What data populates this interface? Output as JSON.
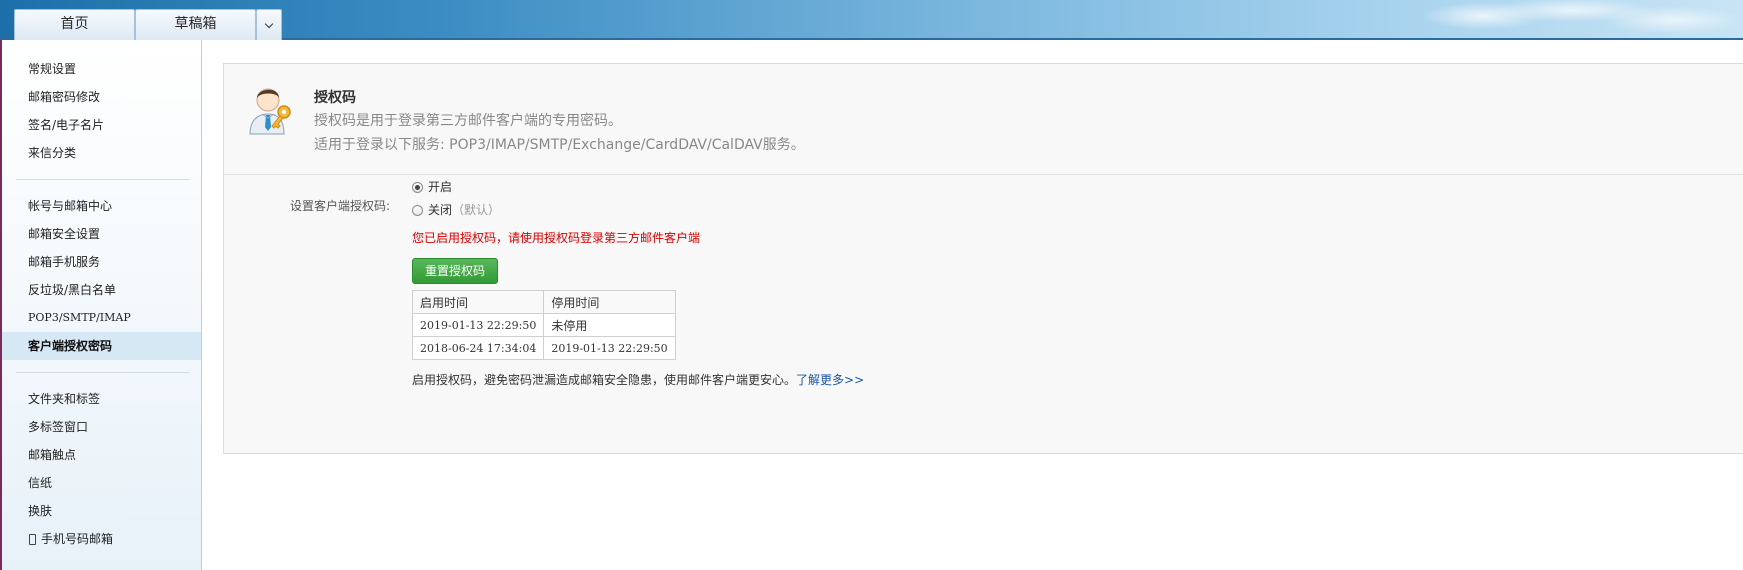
{
  "header": {
    "tabs": [
      {
        "label": "首页"
      },
      {
        "label": "草稿箱"
      }
    ]
  },
  "sidebar": {
    "groups": [
      {
        "items": [
          {
            "label": "常规设置"
          },
          {
            "label": "邮箱密码修改"
          },
          {
            "label": "签名/电子名片"
          },
          {
            "label": "来信分类"
          }
        ]
      },
      {
        "items": [
          {
            "label": "帐号与邮箱中心"
          },
          {
            "label": "邮箱安全设置"
          },
          {
            "label": "邮箱手机服务"
          },
          {
            "label": "反垃圾/黑白名单"
          },
          {
            "label": "POP3/SMTP/IMAP"
          },
          {
            "label": "客户端授权密码",
            "active": true
          }
        ]
      },
      {
        "items": [
          {
            "label": "文件夹和标签"
          },
          {
            "label": "多标签窗口"
          },
          {
            "label": "邮箱触点"
          },
          {
            "label": "信纸"
          },
          {
            "label": "换肤"
          },
          {
            "label": "手机号码邮箱",
            "icon": "phone-icon"
          }
        ]
      }
    ]
  },
  "main": {
    "title": "授权码",
    "desc_line1": "授权码是用于登录第三方邮件客户端的专用密码。",
    "desc_line2": "适用于登录以下服务: POP3/IMAP/SMTP/Exchange/CardDAV/CalDAV服务。",
    "header_icon": "user-key-icon",
    "setting_label": "设置客户端授权码:",
    "options": {
      "on_label": "开启",
      "off_label": "关闭",
      "off_hint": "（默认）",
      "selected": "on"
    },
    "warning": "您已启用授权码，请使用授权码登录第三方邮件客户端",
    "reset_button": "重置授权码",
    "table": {
      "headers": [
        "启用时间",
        "停用时间"
      ],
      "rows": [
        [
          "2019-01-13 22:29:50",
          "未停用"
        ],
        [
          "2018-06-24 17:34:04",
          "2019-01-13 22:29:50"
        ]
      ]
    },
    "footer_text": "启用授权码，避免密码泄漏造成邮箱安全隐患，使用邮件客户端更安心。",
    "learn_more": "了解更多>>"
  },
  "colors": {
    "warning": "#d40000",
    "button": "#3aa23d",
    "link": "#1a55a6",
    "header_blue": "#3b8cc3"
  }
}
